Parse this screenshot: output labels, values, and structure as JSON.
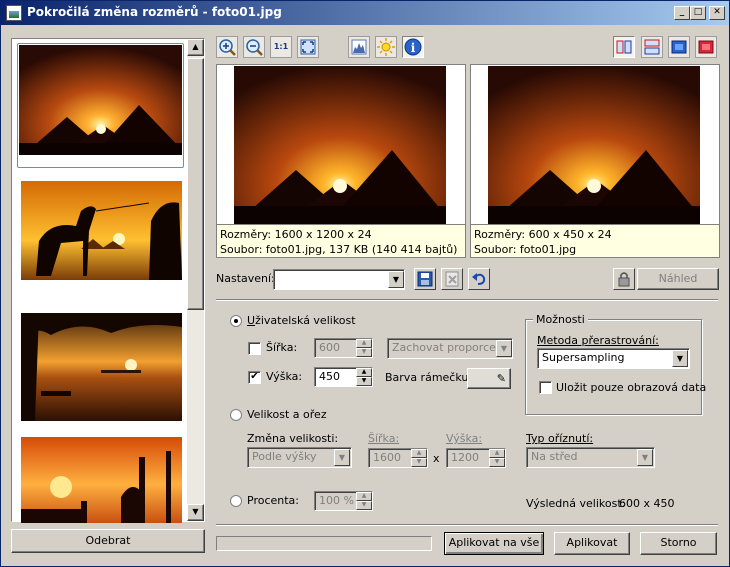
{
  "window": {
    "title": "Pokročilá změna rozměrů - foto01.jpg",
    "controls": [
      "_",
      "□",
      "✕"
    ]
  },
  "sidebar": {
    "thumbnails": [
      "foto01.jpg",
      "foto02.jpg",
      "foto03.jpg",
      "foto04.jpg"
    ],
    "remove_label": "Odebrat"
  },
  "toolbar": {
    "left_icons": [
      "zoom-in-icon",
      "zoom-out-icon",
      "actual-size-icon",
      "fit-icon",
      "histogram-icon",
      "brightness-icon",
      "info-icon"
    ],
    "actual_size_text": "1:1",
    "right_icons": [
      "split-vertical-icon",
      "split-horizontal-icon",
      "single-view-blue-icon",
      "single-view-red-icon"
    ]
  },
  "preview": {
    "original": {
      "line1": "Rozměry: 1600 x 1200 x 24",
      "line2": "Soubor: foto01.jpg, 137 KB (140 414 bajtů)"
    },
    "result": {
      "line1": "Rozměry: 600 x 450 x 24",
      "line2": "Soubor: foto01.jpg"
    }
  },
  "settings": {
    "label": "Nastavení:",
    "value": "",
    "preview_button": "Náhled"
  },
  "custom_size": {
    "label_u": "U",
    "label_rest": "živatelská velikost",
    "width_label": "Šířka:",
    "width_value": "600",
    "width_checked": false,
    "height_label": "Výška:",
    "height_value": "450",
    "height_checked": true,
    "proportion_select": "Zachovat proporce",
    "frame_color_label": "Barva rámečku:"
  },
  "options": {
    "group_label": "Možnosti",
    "method_label": "Metoda přerastrování:",
    "method_value": "Supersampling",
    "save_image_only_label": "Uložit pouze obrazová data"
  },
  "size_crop": {
    "label": "Velikost a ořez",
    "resize_label": "Změna velikosti:",
    "resize_value": "Podle výšky",
    "width_label": "Šířka:",
    "width_value": "1600",
    "x": "x",
    "height_label": "Výška:",
    "height_value": "1200",
    "crop_label": "Typ oříznutí:",
    "crop_value": "Na střed"
  },
  "percent": {
    "label": "Procenta:",
    "value": "100 %"
  },
  "result_size": {
    "label": "Výsledná velikost:",
    "value": "600 x 450"
  },
  "footer": {
    "apply_all": "Aplikovat na vše",
    "apply": "Aplikovat",
    "cancel": "Storno"
  }
}
